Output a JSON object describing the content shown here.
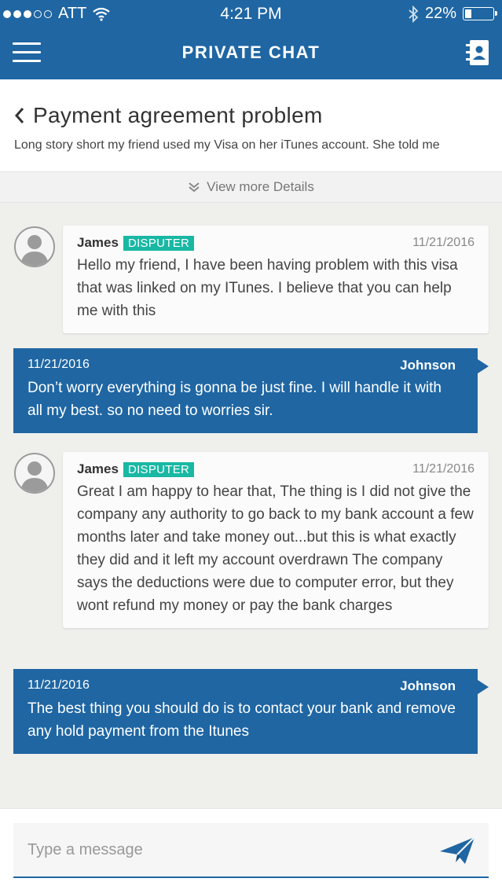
{
  "status_bar": {
    "carrier": "ATT",
    "time": "4:21 PM",
    "battery": "22%"
  },
  "nav": {
    "title": "PRIVATE CHAT"
  },
  "dispute": {
    "title": "Payment agreement problem",
    "description": "Long story short my friend used my Visa on her iTunes account. She told me",
    "more_label": "View more Details"
  },
  "messages": [
    {
      "direction": "incoming",
      "name": "James",
      "badge": "DISPUTER",
      "date": "11/21/2016",
      "text": "Hello my friend, I have been having problem with this visa that was linked on my ITunes. I believe that you can help me with this"
    },
    {
      "direction": "outgoing",
      "name": "Johnson",
      "date": "11/21/2016",
      "text": "Don’t worry everything is gonna be just fine. I will handle it with all my best. so no need to worries sir."
    },
    {
      "direction": "incoming",
      "name": "James",
      "badge": "DISPUTER",
      "date": "11/21/2016",
      "text": "Great I am happy to hear that, The thing is I did not give the company any authority to go back to my bank account a few months later and take money out...but this is what exactly they did and it left my account overdrawn The company says the deductions were due to computer error, but they wont refund my money or pay the bank charges"
    },
    {
      "direction": "outgoing",
      "name": "Johnson",
      "date": "11/21/2016",
      "text": "The best  thing you should do is to contact your bank and remove any hold payment  from the Itunes"
    }
  ],
  "composer": {
    "placeholder": "Type a message"
  },
  "colors": {
    "brand_blue": "#1f66a3",
    "badge_teal": "#19b8a3",
    "background": "#efefec"
  },
  "icons": {
    "menu": "hamburger-menu-icon",
    "contacts": "contacts-book-icon",
    "back": "chevron-left-icon",
    "expand": "double-chevron-down-icon",
    "send": "paper-plane-icon",
    "avatar": "user-silhouette-icon"
  }
}
